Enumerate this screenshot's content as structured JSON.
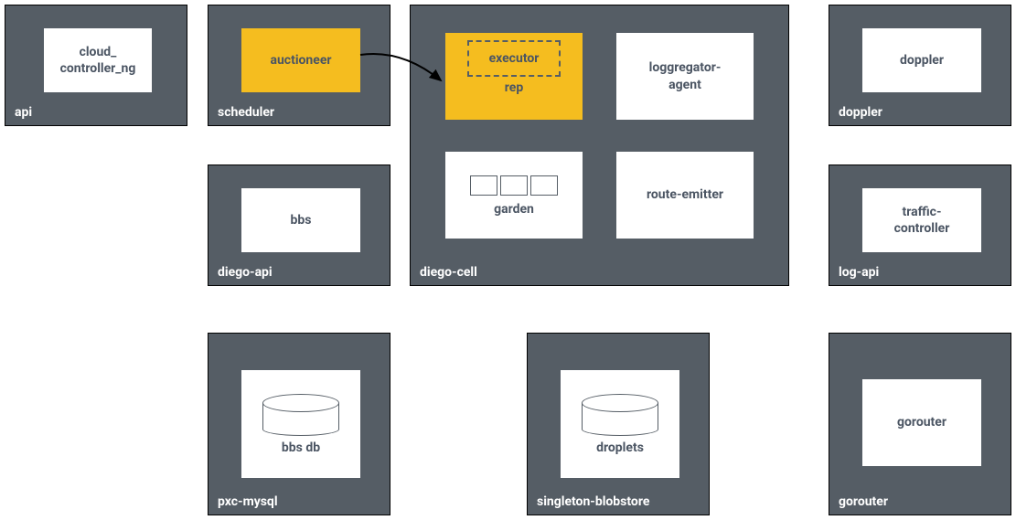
{
  "colors": {
    "container_bg": "#555d65",
    "highlight_bg": "#f5bd1f",
    "text": "#4b5563"
  },
  "containers": {
    "api": {
      "label": "api",
      "box": "cloud_\ncontroller_ng"
    },
    "scheduler": {
      "label": "scheduler",
      "box": "auctioneer"
    },
    "diego_api": {
      "label": "diego-api",
      "box": "bbs"
    },
    "pxc_mysql": {
      "label": "pxc-mysql",
      "box": "bbs db"
    },
    "diego_cell": {
      "label": "diego-cell",
      "rep": {
        "inner": "executor",
        "label": "rep"
      },
      "loggregator": "loggregator-\nagent",
      "garden": "garden",
      "route_emitter": "route-emitter"
    },
    "singleton_blobstore": {
      "label": "singleton-blobstore",
      "box": "droplets"
    },
    "doppler": {
      "label": "doppler",
      "box": "doppler"
    },
    "log_api": {
      "label": "log-api",
      "box": "traffic-\ncontroller"
    },
    "gorouter": {
      "label": "gorouter",
      "box": "gorouter"
    }
  }
}
